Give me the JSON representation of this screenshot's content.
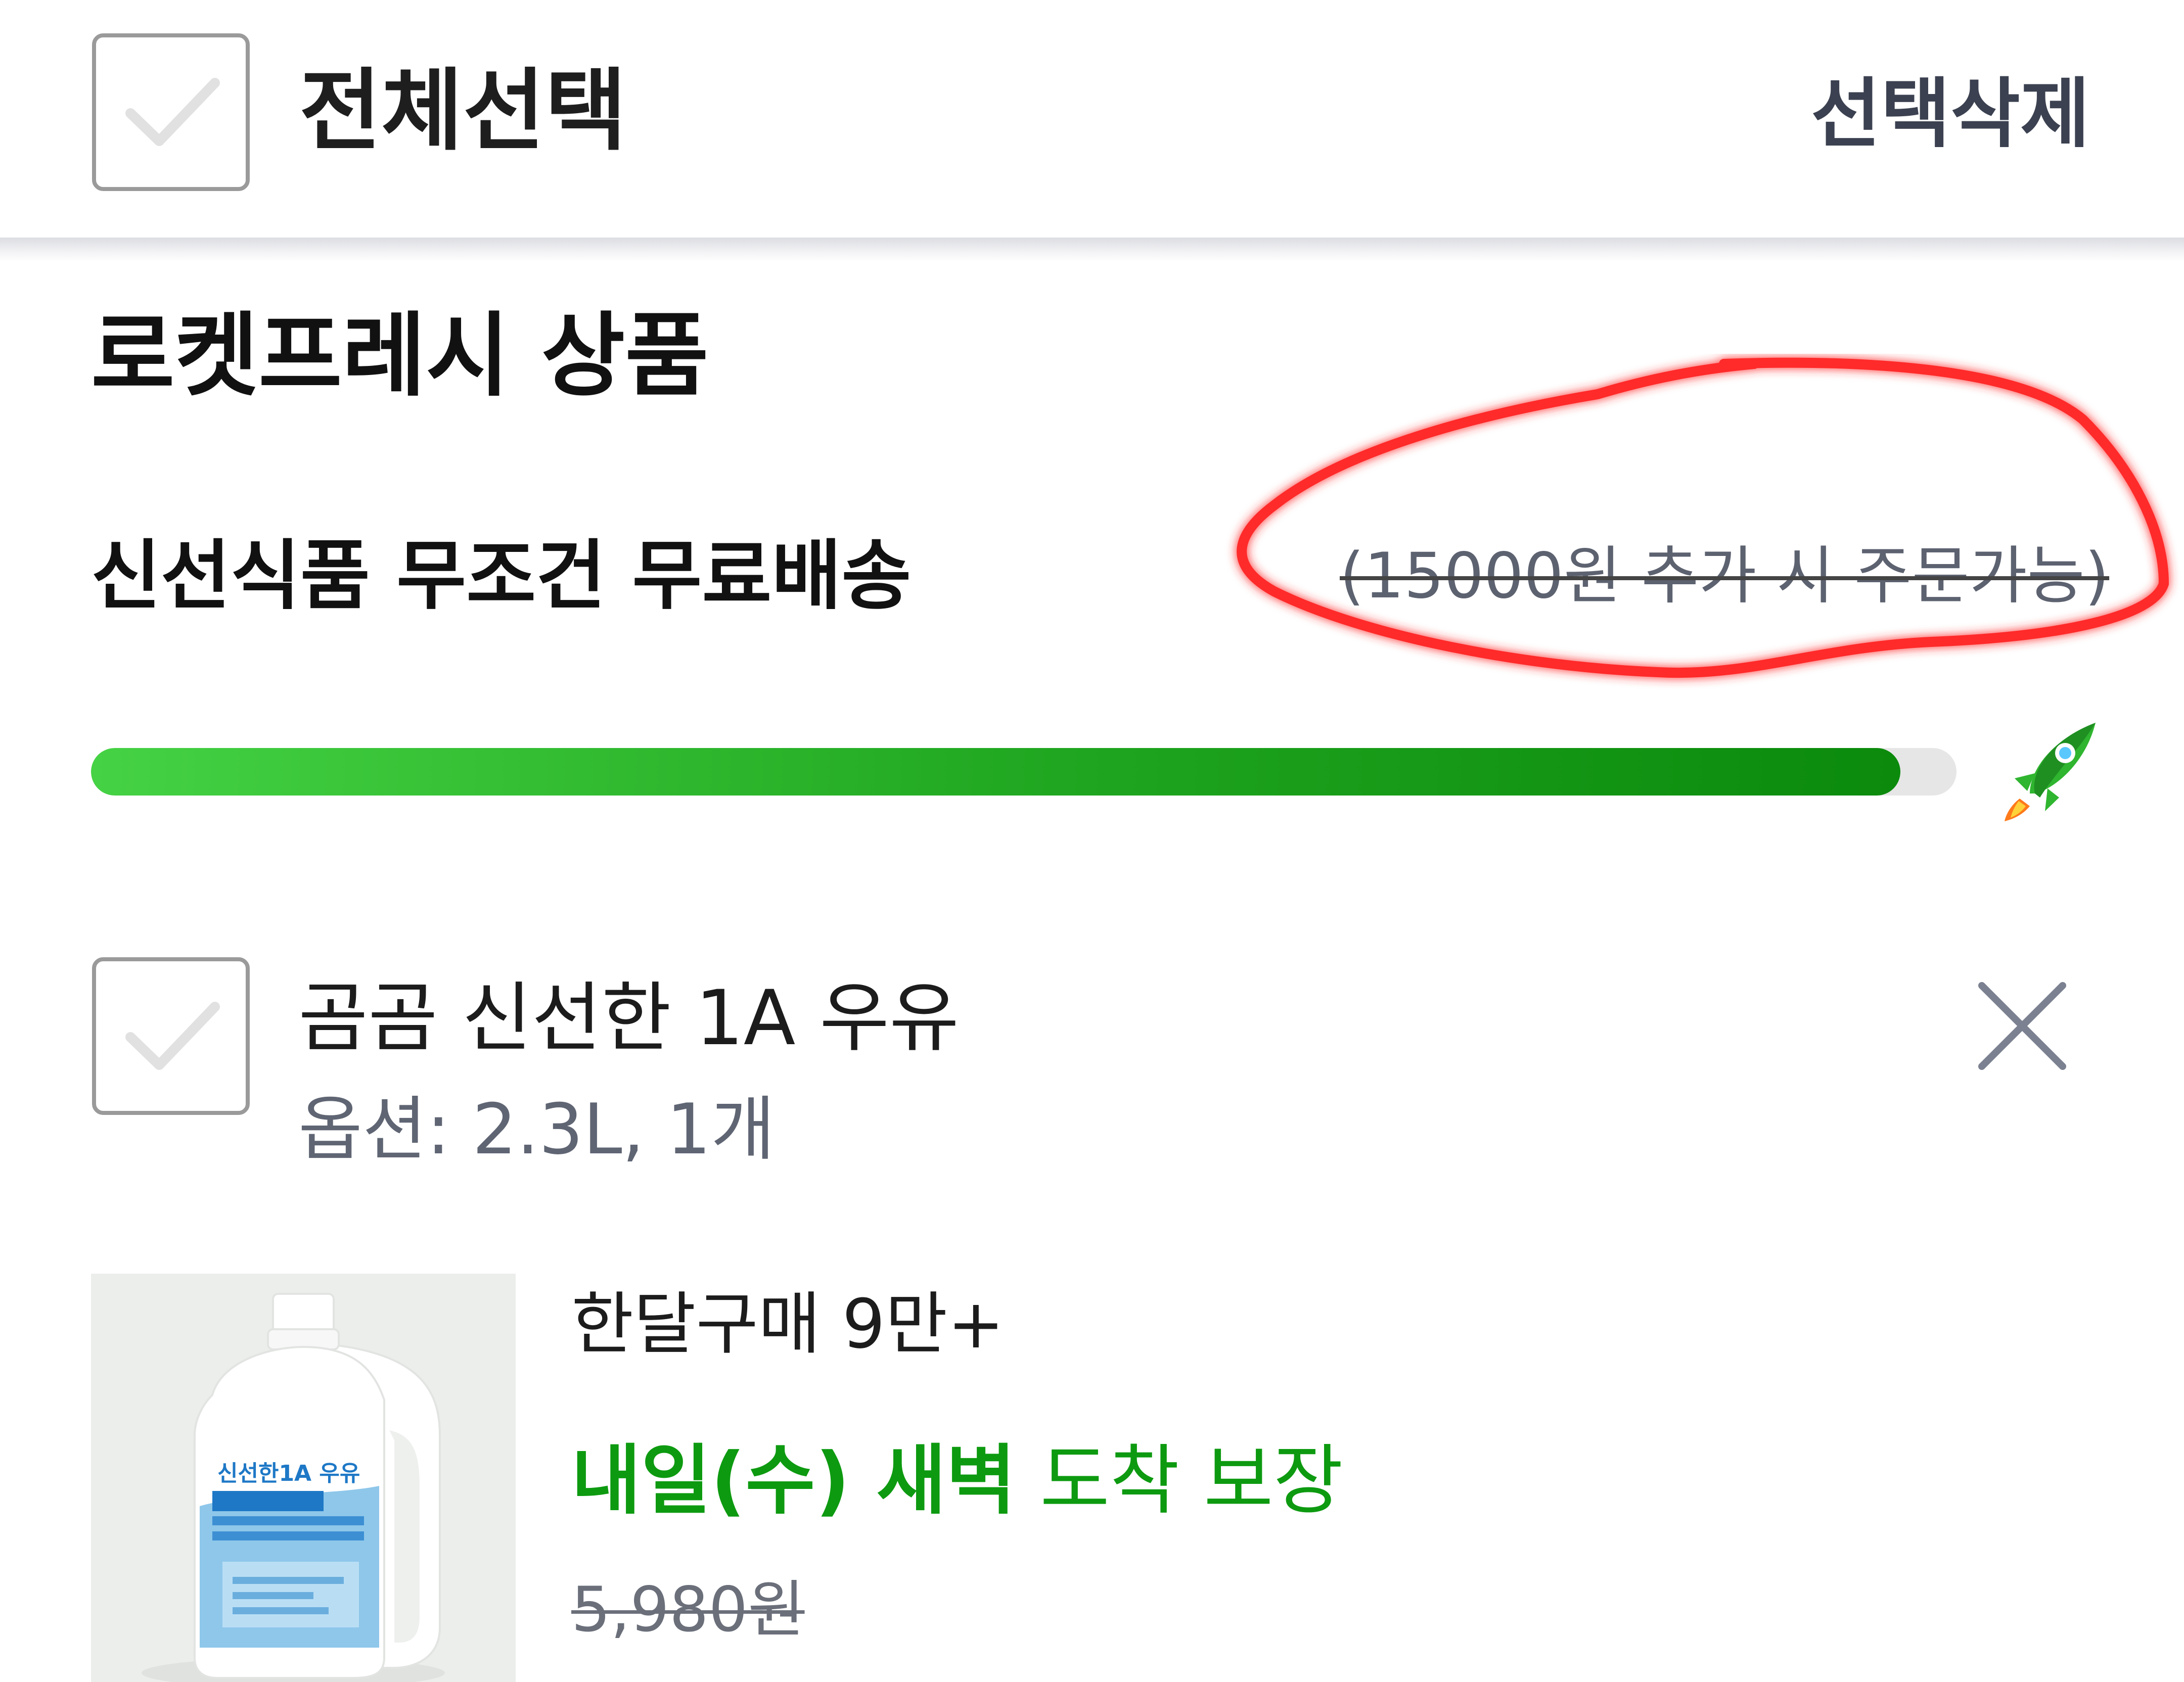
{
  "header": {
    "select_all_label": "전체선택",
    "delete_selected_label": "선택삭제"
  },
  "section": {
    "title": "로켓프레시 상품",
    "free_shipping_label": "신선식품 무조건 무료배송",
    "order_note": "(15000원 추가 시 주문가능)",
    "progress_fraction": 0.97
  },
  "item": {
    "name": "곰곰 신선한 1A 우유",
    "option": "옵션: 2.3L, 1개",
    "monthly_purchases": "한달구매 9만+",
    "delivery_bold": "내일(수) 새벽",
    "delivery_rest": " 도착 보장",
    "price": "5,980원",
    "product_label_text": "신선한1A 우유"
  },
  "colors": {
    "accent_green": "#0d9a10",
    "progress_start": "#45d244",
    "progress_end": "#0b8a0c",
    "annotation_red": "#ff2a2a"
  },
  "icons": {
    "checkbox": "check-icon",
    "remove": "close-icon",
    "progress_end": "rocket-icon"
  }
}
